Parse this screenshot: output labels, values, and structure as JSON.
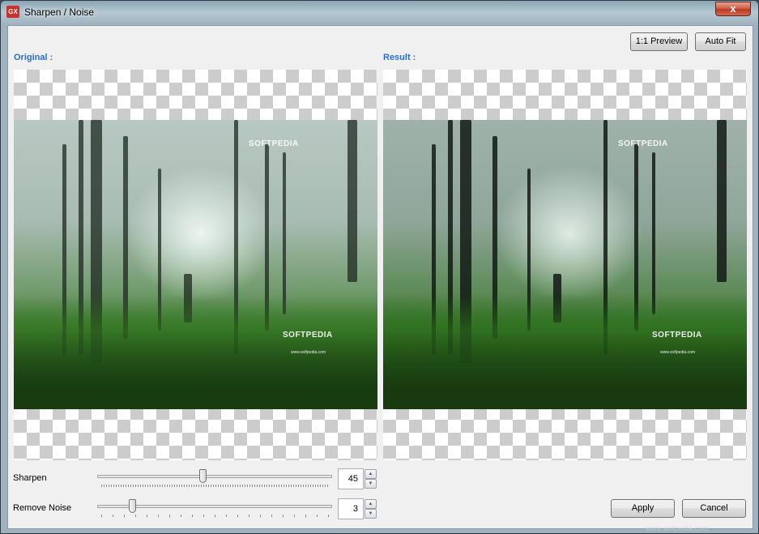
{
  "window": {
    "title": "Sharpen / Noise",
    "app_icon": "GX",
    "close_glyph": "x"
  },
  "toolbar": {
    "preview_label": "1:1 Preview",
    "autofit_label": "Auto Fit"
  },
  "panes": {
    "original_label": "Original :",
    "result_label": "Result :",
    "watermark_top": "SOFTPEDIA",
    "watermark_bottom": "SOFTPEDIA",
    "watermark_url": "www.softpedia.com"
  },
  "controls": {
    "sharpen": {
      "label": "Sharpen",
      "value": "45",
      "level": 45,
      "max": 100
    },
    "noise": {
      "label": "Remove Noise",
      "value": "3",
      "level": 3,
      "max": 20
    }
  },
  "actions": {
    "apply_label": "Apply",
    "cancel_label": "Cancel"
  },
  "footer": {
    "watermark": "www.softpedia.com"
  },
  "colors": {
    "label_accent": "#2a6fc9",
    "close_button": "#c8422a"
  }
}
